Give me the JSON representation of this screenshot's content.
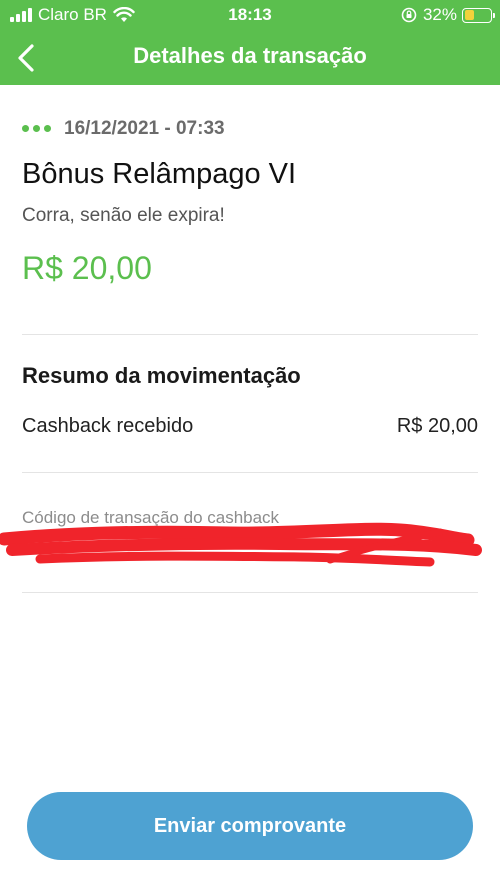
{
  "status_bar": {
    "carrier": "Claro BR",
    "time": "18:13",
    "battery_percent": "32%",
    "icons": [
      "signal-icon",
      "wifi-icon",
      "orientation-lock-icon",
      "battery-icon"
    ]
  },
  "nav": {
    "title": "Detalhes da transação",
    "back_icon": "chevron-left-icon"
  },
  "transaction": {
    "datetime": "16/12/2021 - 07:33",
    "title": "Bônus Relâmpago VI",
    "subtitle": "Corra, senão ele expira!",
    "amount": "R$ 20,00"
  },
  "summary": {
    "heading": "Resumo da movimentação",
    "rows": [
      {
        "label": "Cashback recebido",
        "value": "R$ 20,00"
      }
    ]
  },
  "cashback_code": {
    "label": "Código de transação do cashback",
    "value": ""
  },
  "actions": {
    "send_receipt_label": "Enviar comprovante"
  },
  "colors": {
    "brand_green": "#5bbf4e",
    "button_blue": "#4ea2d2",
    "redaction_red": "#f0242b"
  }
}
